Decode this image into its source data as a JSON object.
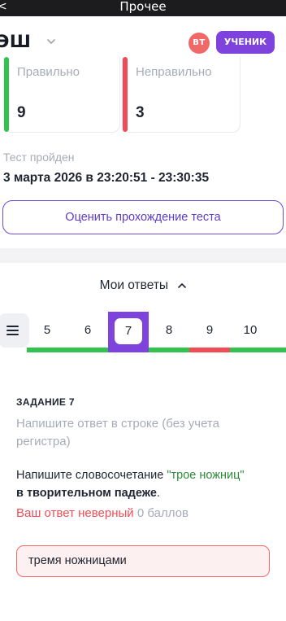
{
  "top_bar": {
    "title": "Прочее",
    "back_glyph": "<"
  },
  "header": {
    "brand": "ЭШ",
    "avatar_initials": "ВТ",
    "role_button": "УЧЕНИК"
  },
  "stats": {
    "correct": {
      "label": "Правильно",
      "value": "9"
    },
    "incorrect": {
      "label": "Неправильно",
      "value": "3"
    }
  },
  "test": {
    "passed_label": "Тест пройден",
    "passed_time": "3 марта 2026 в 23:20:51 - 23:30:35"
  },
  "rate_button": "Оценить прохождение теста",
  "answers": {
    "title": "Мои ответы",
    "questions": [
      {
        "num": "5",
        "status": "correct"
      },
      {
        "num": "6",
        "status": "correct"
      },
      {
        "num": "7",
        "status": "incorrect",
        "active": true
      },
      {
        "num": "8",
        "status": "correct"
      },
      {
        "num": "9",
        "status": "incorrect"
      },
      {
        "num": "10",
        "status": "correct"
      }
    ]
  },
  "task": {
    "title": "ЗАДАНИЕ 7",
    "hint": "Напишите ответ в строке (без учета регистра)",
    "text_before": "Напишите словосочетание ",
    "text_quote": "\"трое ножниц\"",
    "text_bold": "в творительном падеже",
    "text_after": ".",
    "verdict": "Ваш ответ неверный",
    "points": "0 баллов",
    "answer": "тремя ножницами"
  },
  "colors": {
    "accent": "#7d43dc",
    "correct": "#34c24e",
    "incorrect": "#ef4c57",
    "avatar": "#f06868"
  }
}
